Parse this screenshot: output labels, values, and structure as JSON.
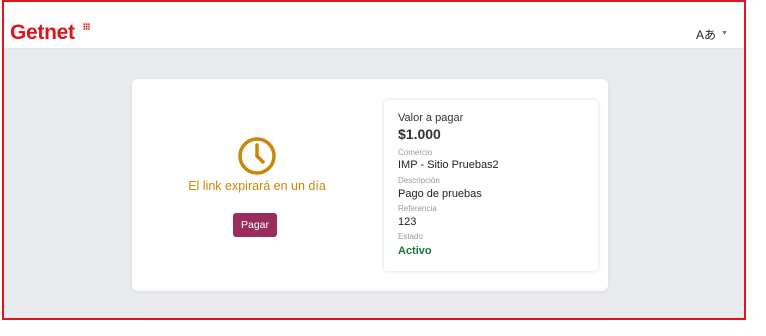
{
  "header": {
    "logo_text": "Getnet",
    "language_label": "Aあ",
    "language_icon": "caret-down-icon"
  },
  "payment": {
    "expire_text": "El link expirará en un día",
    "pay_button": "Pagar",
    "clock_icon": "clock-icon",
    "accent_color": "#c98809",
    "button_color": "#9b2c5e"
  },
  "details": {
    "amount_label": "Valor a pagar",
    "amount": "$1.000",
    "merchant_label": "Comercio",
    "merchant": "IMP - Sitio Pruebas2",
    "description_label": "Descripción",
    "description": "Pago de pruebas",
    "reference_label": "Referencia",
    "reference": "123",
    "status_label": "Estado",
    "status": "Activo",
    "status_color": "#0e7a3a"
  },
  "brand_color": "#e0151b"
}
